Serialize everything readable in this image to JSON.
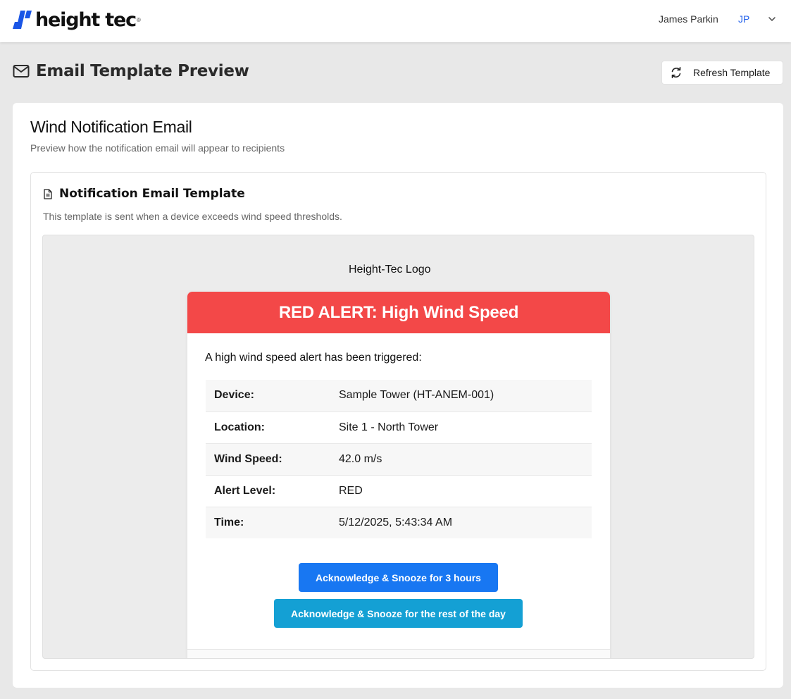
{
  "topbar": {
    "logo_text": "height tec",
    "logo_registered": "®",
    "user_name": "James Parkin",
    "user_initials": "JP",
    "menu_icon": "chevron-down-icon"
  },
  "header": {
    "title": "Email Template Preview",
    "title_icon": "mail-icon",
    "refresh_label": "Refresh Template",
    "refresh_icon": "refresh-icon"
  },
  "card": {
    "title": "Wind Notification Email",
    "subtitle": "Preview how the notification email will appear to recipients"
  },
  "template_section": {
    "icon": "document-icon",
    "title": "Notification Email Template",
    "description": "This template is sent when a device exceeds wind speed thresholds."
  },
  "email": {
    "logo_alt": "Height-Tec Logo",
    "header": "RED ALERT: High Wind Speed",
    "header_color": "#f34848",
    "intro": "A high wind speed alert has been triggered:",
    "details": [
      {
        "label": "Device:",
        "value": "Sample Tower (HT-ANEM-001)"
      },
      {
        "label": "Location:",
        "value": "Site 1 - North Tower"
      },
      {
        "label": "Wind Speed:",
        "value": "42.0 m/s"
      },
      {
        "label": "Alert Level:",
        "value": "RED"
      },
      {
        "label": "Time:",
        "value": "5/12/2025, 5:43:34 AM"
      }
    ],
    "buttons": {
      "snooze_3h": "Acknowledge & Snooze for 3 hours",
      "snooze_day": "Acknowledge & Snooze for the rest of the day"
    },
    "button_colors": {
      "snooze_3h": "#1877f2",
      "snooze_day": "#14a0d4"
    }
  }
}
